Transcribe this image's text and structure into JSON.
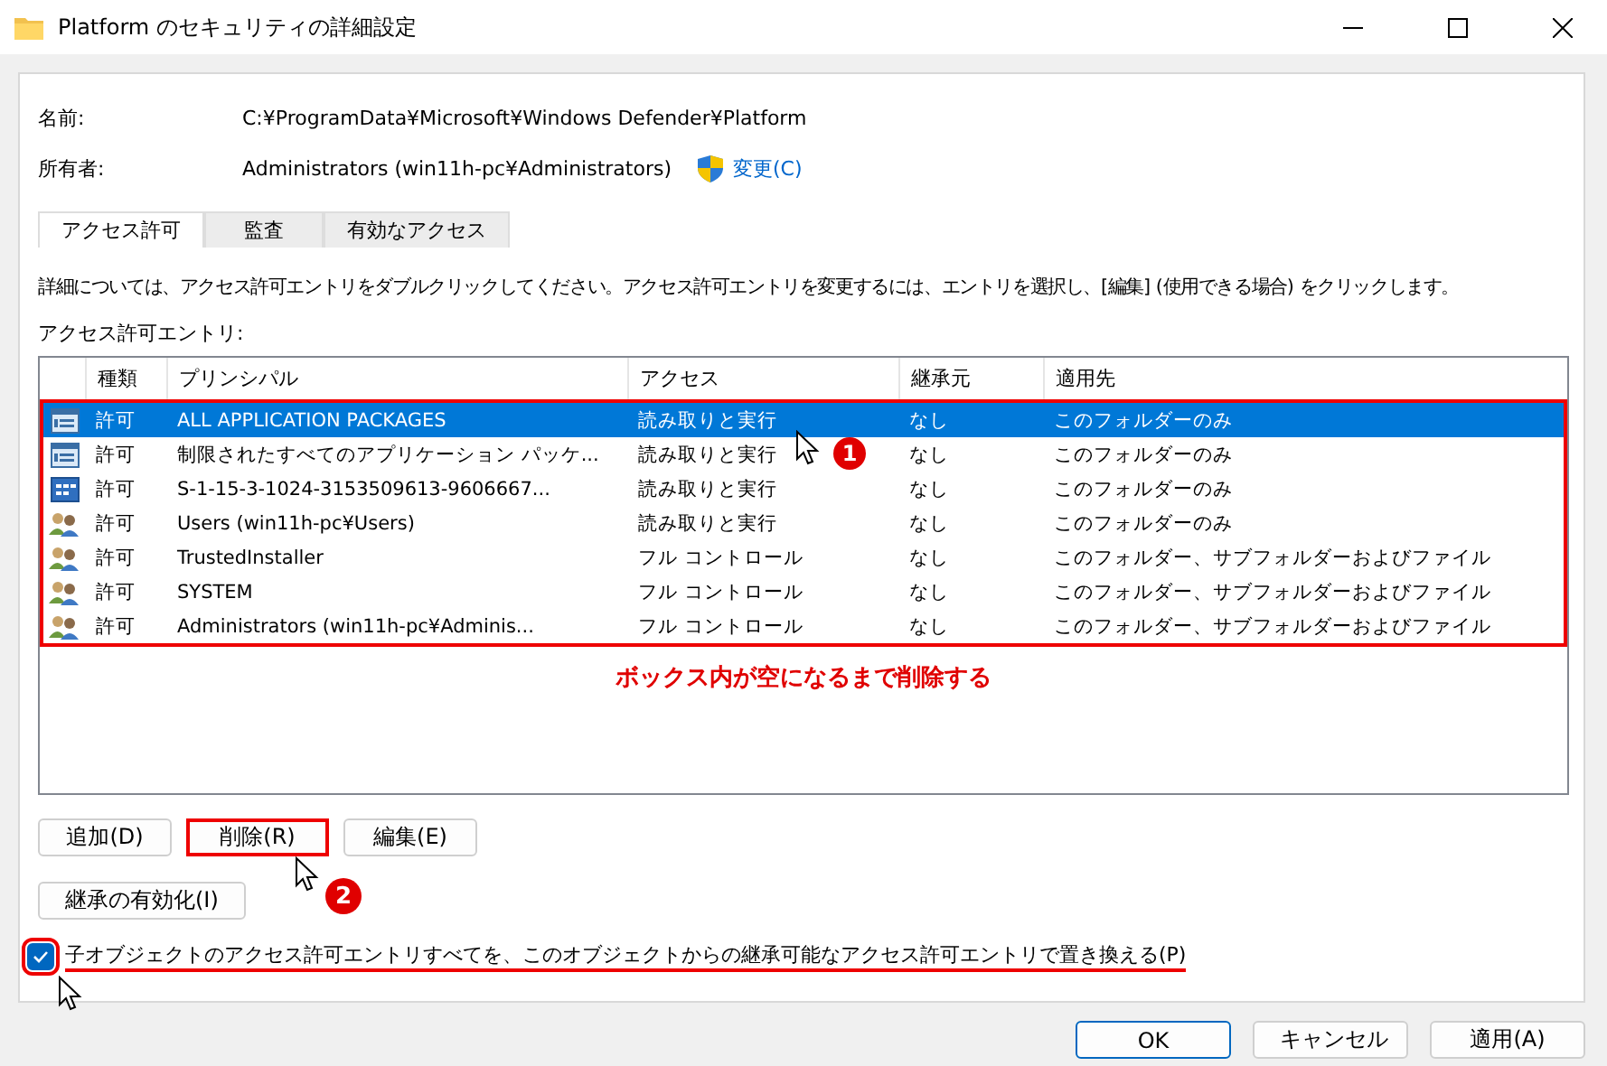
{
  "window": {
    "title": "Platform のセキュリティの詳細設定"
  },
  "name": {
    "label": "名前:",
    "value": "C:¥ProgramData¥Microsoft¥Windows Defender¥Platform"
  },
  "owner": {
    "label": "所有者:",
    "value": "Administrators (win11h-pc¥Administrators)",
    "link": "変更(C)"
  },
  "tabs": [
    {
      "label": "アクセス許可",
      "selected": true
    },
    {
      "label": "監査",
      "selected": false
    },
    {
      "label": "有効なアクセス",
      "selected": false
    }
  ],
  "instructions": "詳細については、アクセス許可エントリをダブルクリックしてください。アクセス許可エントリを変更するには、エントリを選択し、[編集] (使用できる場合) をクリックします。",
  "entries_label": "アクセス許可エントリ:",
  "table": {
    "columns": [
      "種類",
      "プリンシパル",
      "アクセス",
      "継承元",
      "適用先"
    ],
    "highlighted": true,
    "rows": [
      {
        "kind": "package",
        "selected": true,
        "cells": [
          "許可",
          "ALL APPLICATION PACKAGES",
          "読み取りと実行",
          "なし",
          "このフォルダーのみ"
        ]
      },
      {
        "kind": "package",
        "selected": false,
        "step": "1",
        "cells": [
          "許可",
          "制限されたすべてのアプリケーション パッケ...",
          "読み取りと実行",
          "なし",
          "このフォルダーのみ"
        ]
      },
      {
        "kind": "sid",
        "selected": false,
        "cells": [
          "許可",
          "S-1-15-3-1024-3153509613-9606667...",
          "読み取りと実行",
          "なし",
          "このフォルダーのみ"
        ]
      },
      {
        "kind": "user",
        "selected": false,
        "cells": [
          "許可",
          "Users (win11h-pc¥Users)",
          "読み取りと実行",
          "なし",
          "このフォルダーのみ"
        ]
      },
      {
        "kind": "user",
        "selected": false,
        "cells": [
          "許可",
          "TrustedInstaller",
          "フル コントロール",
          "なし",
          "このフォルダー、サブフォルダーおよびファイル"
        ]
      },
      {
        "kind": "user",
        "selected": false,
        "cells": [
          "許可",
          "SYSTEM",
          "フル コントロール",
          "なし",
          "このフォルダー、サブフォルダーおよびファイル"
        ]
      },
      {
        "kind": "user",
        "selected": false,
        "cells": [
          "許可",
          "Administrators (win11h-pc¥Adminis...",
          "フル コントロール",
          "なし",
          "このフォルダー、サブフォルダーおよびファイル"
        ]
      }
    ],
    "note": "ボックス内が空になるまで削除する"
  },
  "entry_buttons": [
    {
      "label": "追加(D)",
      "highlighted": false
    },
    {
      "label": "削除(R)",
      "highlighted": true
    },
    {
      "label": "編集(E)",
      "highlighted": false
    }
  ],
  "inheritance_button": "継承の有効化(I)",
  "replace_checkbox": {
    "label": "子オブジェクトのアクセス許可エントリすべてを、このオブジェクトからの継承可能なアクセス許可エントリで置き換える(P)",
    "checked": true,
    "highlighted": true
  },
  "steps": [
    "2"
  ],
  "dialog_buttons": [
    {
      "label": "OK",
      "default": true
    },
    {
      "label": "キャンセル",
      "default": false
    },
    {
      "label": "適用(A)",
      "default": false
    }
  ]
}
